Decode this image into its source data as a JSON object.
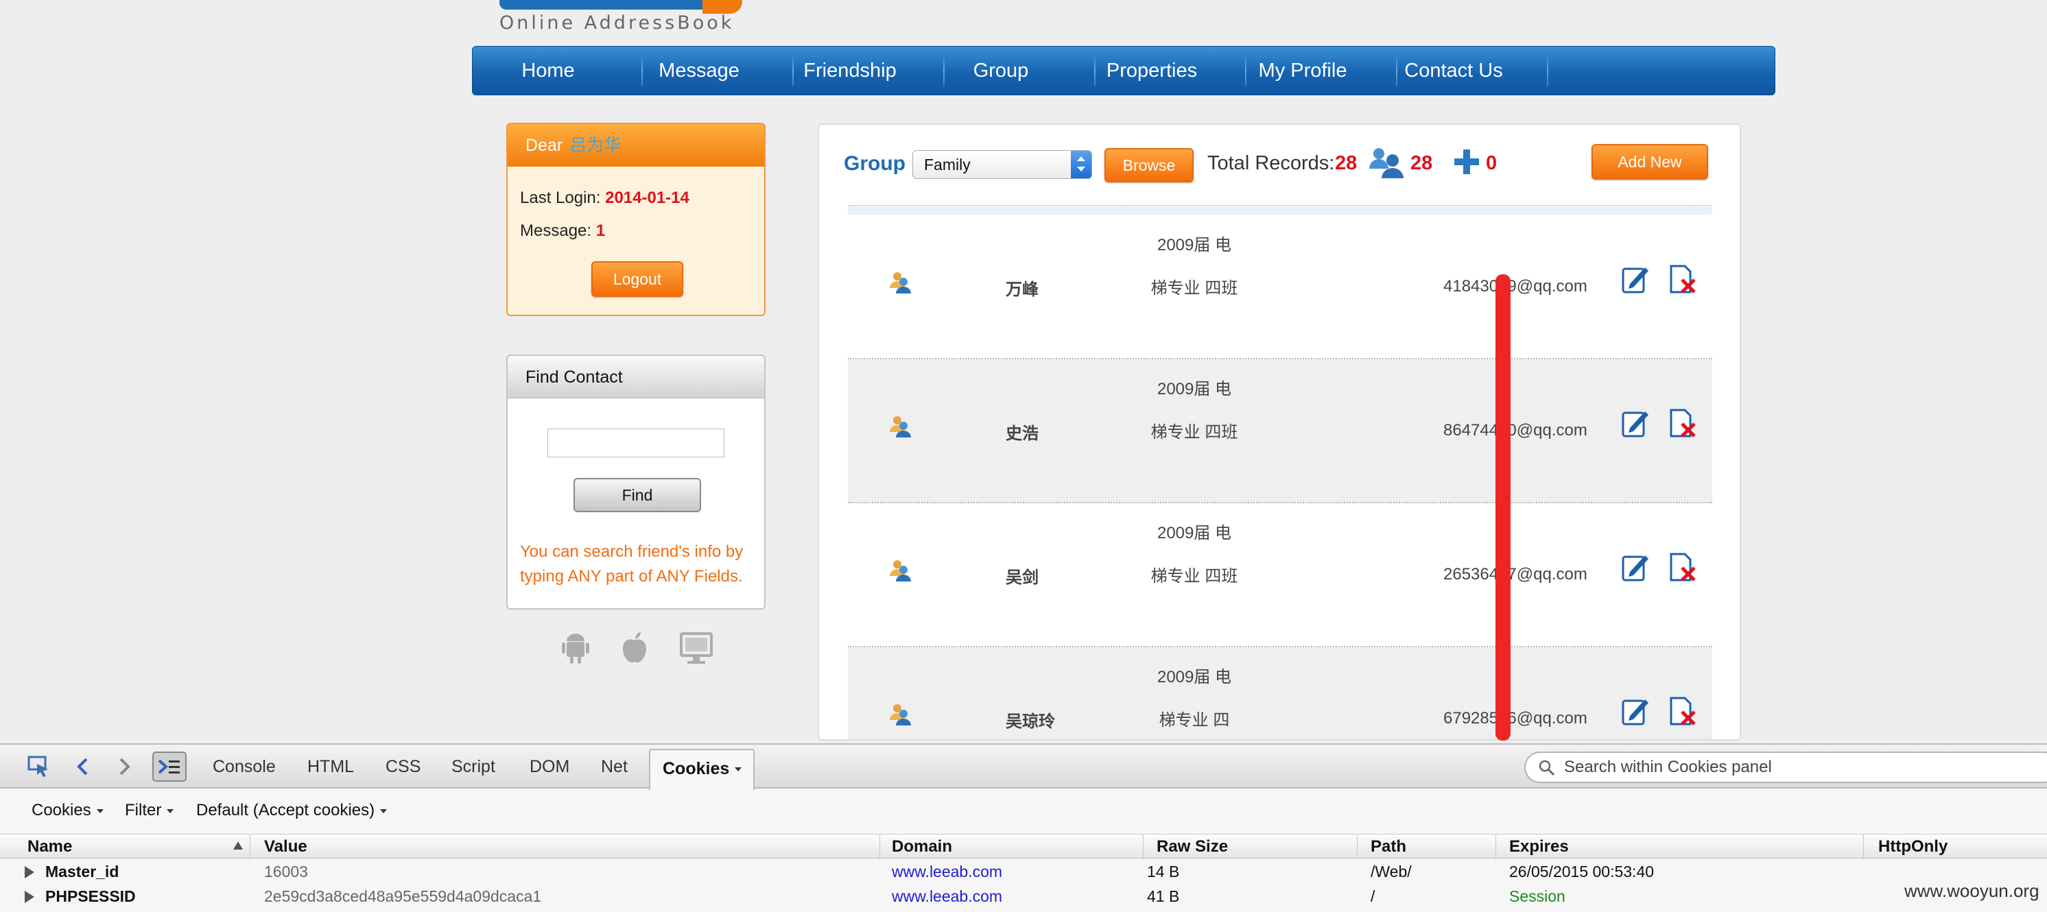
{
  "logo": {
    "text": "Online AddressBook"
  },
  "nav": {
    "items": [
      "Home",
      "Message",
      "Friendship",
      "Group",
      "Properties",
      "My Profile",
      "Contact Us"
    ]
  },
  "welcome": {
    "dear_label": "Dear",
    "user_name": "吕为华",
    "last_login_label": "Last Login:",
    "last_login_value": "2014-01-14",
    "message_label": "Message:",
    "message_value": "1",
    "logout_label": "Logout"
  },
  "find": {
    "title": "Find Contact",
    "input_value": "",
    "button_label": "Find",
    "hint": "You can search friend's info by typing ANY part of ANY Fields."
  },
  "main": {
    "group_label": "Group",
    "group_selected": "Family",
    "browse_label": "Browse",
    "total_label": "Total Records:",
    "total_value": "28",
    "friends_count": "28",
    "pending_count": "0",
    "add_new_label": "Add New"
  },
  "contacts": [
    {
      "name": "万峰",
      "class_info": "2009届 电梯专业 四班",
      "email": "41843099@qq.com"
    },
    {
      "name": "史浩",
      "class_info": "2009届 电梯专业 四班",
      "email": "86474430@qq.com"
    },
    {
      "name": "吴剑",
      "class_info": "2009届 电梯专业 四班",
      "email": "26536427@qq.com"
    },
    {
      "name": "吴琼玲",
      "class_info": "2009届 电梯专业 四",
      "email": "67928536@qq.com"
    }
  ],
  "devtools": {
    "tabs": [
      "Console",
      "HTML",
      "CSS",
      "Script",
      "DOM",
      "Net"
    ],
    "active_tab": "Cookies",
    "search_placeholder": "Search within Cookies panel",
    "sub_items": [
      "Cookies",
      "Filter",
      "Default (Accept cookies)"
    ],
    "columns": [
      "Name",
      "Value",
      "Domain",
      "Raw Size",
      "Path",
      "Expires",
      "HttpOnly"
    ],
    "cookies": [
      {
        "name": "Master_id",
        "value": "16003",
        "domain": "www.leeab.com",
        "raw_size": "14 B",
        "path": "/Web/",
        "expires": "26/05/2015 00:53:40"
      },
      {
        "name": "PHPSESSID",
        "value": "2e59cd3a8ced48a95e559d4a09dcaca1",
        "domain": "www.leeab.com",
        "raw_size": "41 B",
        "path": "/",
        "expires": "Session"
      }
    ]
  },
  "watermark": "www.wooyun.org",
  "colors": {
    "nav_blue": "#1763b0",
    "accent_orange": "#f27d10",
    "stat_red": "#e0121b",
    "session_green": "#1a8a1a"
  }
}
